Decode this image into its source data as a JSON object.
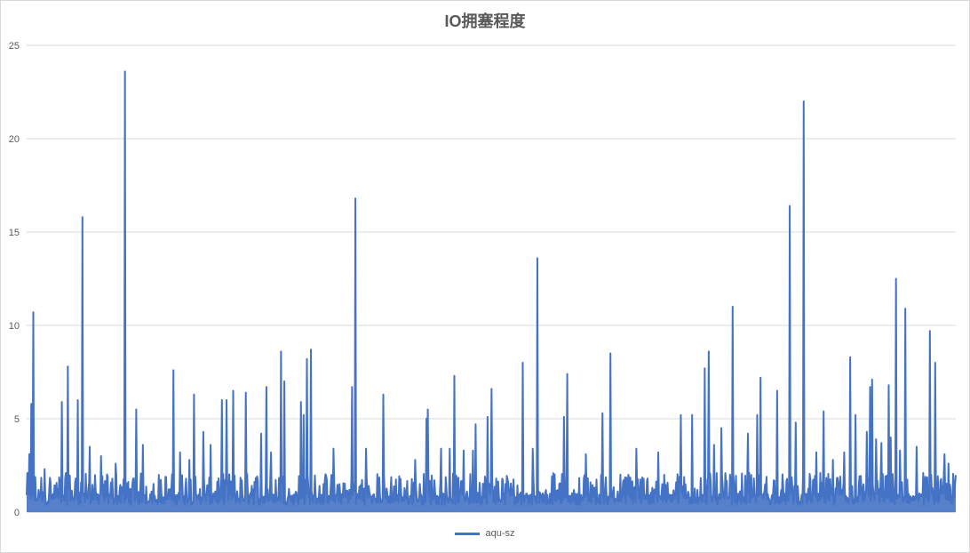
{
  "chart_data": {
    "type": "line",
    "title": "IO拥塞程度",
    "xlabel": "",
    "ylabel": "",
    "ylim": [
      0,
      25
    ],
    "yticks": [
      0,
      5,
      10,
      15,
      20,
      25
    ],
    "grid": true,
    "legend_position": "bottom",
    "series": [
      {
        "name": "aqu-sz",
        "color": "#4472c4",
        "baseline_range": [
          0.4,
          2.1
        ],
        "spikes": [
          {
            "x": 0.003,
            "y": 3.1
          },
          {
            "x": 0.005,
            "y": 5.8
          },
          {
            "x": 0.007,
            "y": 10.7
          },
          {
            "x": 0.019,
            "y": 2.3
          },
          {
            "x": 0.038,
            "y": 5.9
          },
          {
            "x": 0.044,
            "y": 7.8
          },
          {
            "x": 0.055,
            "y": 6.0
          },
          {
            "x": 0.06,
            "y": 15.8
          },
          {
            "x": 0.068,
            "y": 3.5
          },
          {
            "x": 0.08,
            "y": 3.0
          },
          {
            "x": 0.096,
            "y": 2.6
          },
          {
            "x": 0.106,
            "y": 23.6
          },
          {
            "x": 0.118,
            "y": 5.5
          },
          {
            "x": 0.125,
            "y": 3.6
          },
          {
            "x": 0.158,
            "y": 7.6
          },
          {
            "x": 0.165,
            "y": 3.2
          },
          {
            "x": 0.175,
            "y": 2.8
          },
          {
            "x": 0.18,
            "y": 6.3
          },
          {
            "x": 0.19,
            "y": 4.3
          },
          {
            "x": 0.198,
            "y": 3.6
          },
          {
            "x": 0.21,
            "y": 6.0
          },
          {
            "x": 0.215,
            "y": 6.0
          },
          {
            "x": 0.222,
            "y": 6.5
          },
          {
            "x": 0.236,
            "y": 6.4
          },
          {
            "x": 0.252,
            "y": 4.2
          },
          {
            "x": 0.258,
            "y": 6.7
          },
          {
            "x": 0.263,
            "y": 3.2
          },
          {
            "x": 0.274,
            "y": 8.6
          },
          {
            "x": 0.277,
            "y": 7.0
          },
          {
            "x": 0.295,
            "y": 5.9
          },
          {
            "x": 0.298,
            "y": 5.2
          },
          {
            "x": 0.302,
            "y": 8.2
          },
          {
            "x": 0.306,
            "y": 8.7
          },
          {
            "x": 0.33,
            "y": 3.4
          },
          {
            "x": 0.35,
            "y": 6.7
          },
          {
            "x": 0.354,
            "y": 16.8
          },
          {
            "x": 0.365,
            "y": 3.4
          },
          {
            "x": 0.384,
            "y": 6.3
          },
          {
            "x": 0.418,
            "y": 2.8
          },
          {
            "x": 0.43,
            "y": 5.0
          },
          {
            "x": 0.432,
            "y": 5.5
          },
          {
            "x": 0.446,
            "y": 3.4
          },
          {
            "x": 0.455,
            "y": 3.4
          },
          {
            "x": 0.46,
            "y": 7.3
          },
          {
            "x": 0.47,
            "y": 3.3
          },
          {
            "x": 0.48,
            "y": 3.3
          },
          {
            "x": 0.483,
            "y": 4.7
          },
          {
            "x": 0.496,
            "y": 5.1
          },
          {
            "x": 0.5,
            "y": 6.6
          },
          {
            "x": 0.534,
            "y": 8.0
          },
          {
            "x": 0.545,
            "y": 3.4
          },
          {
            "x": 0.55,
            "y": 13.6
          },
          {
            "x": 0.578,
            "y": 5.1
          },
          {
            "x": 0.582,
            "y": 7.4
          },
          {
            "x": 0.602,
            "y": 3.1
          },
          {
            "x": 0.62,
            "y": 5.3
          },
          {
            "x": 0.628,
            "y": 8.5
          },
          {
            "x": 0.656,
            "y": 3.4
          },
          {
            "x": 0.68,
            "y": 3.2
          },
          {
            "x": 0.704,
            "y": 5.2
          },
          {
            "x": 0.716,
            "y": 5.2
          },
          {
            "x": 0.73,
            "y": 7.7
          },
          {
            "x": 0.734,
            "y": 8.6
          },
          {
            "x": 0.74,
            "y": 3.6
          },
          {
            "x": 0.748,
            "y": 4.5
          },
          {
            "x": 0.76,
            "y": 11.0
          },
          {
            "x": 0.776,
            "y": 4.2
          },
          {
            "x": 0.786,
            "y": 5.2
          },
          {
            "x": 0.79,
            "y": 7.2
          },
          {
            "x": 0.808,
            "y": 6.5
          },
          {
            "x": 0.821,
            "y": 16.4
          },
          {
            "x": 0.828,
            "y": 4.8
          },
          {
            "x": 0.836,
            "y": 22.0
          },
          {
            "x": 0.85,
            "y": 3.2
          },
          {
            "x": 0.858,
            "y": 5.4
          },
          {
            "x": 0.868,
            "y": 2.8
          },
          {
            "x": 0.88,
            "y": 3.2
          },
          {
            "x": 0.886,
            "y": 8.3
          },
          {
            "x": 0.892,
            "y": 5.2
          },
          {
            "x": 0.904,
            "y": 4.3
          },
          {
            "x": 0.908,
            "y": 6.7
          },
          {
            "x": 0.91,
            "y": 7.1
          },
          {
            "x": 0.914,
            "y": 3.9
          },
          {
            "x": 0.92,
            "y": 3.7
          },
          {
            "x": 0.928,
            "y": 6.8
          },
          {
            "x": 0.93,
            "y": 4.0
          },
          {
            "x": 0.936,
            "y": 12.5
          },
          {
            "x": 0.94,
            "y": 3.3
          },
          {
            "x": 0.946,
            "y": 10.9
          },
          {
            "x": 0.958,
            "y": 3.5
          },
          {
            "x": 0.965,
            "y": 2.1
          },
          {
            "x": 0.972,
            "y": 9.7
          },
          {
            "x": 0.978,
            "y": 8.0
          },
          {
            "x": 0.988,
            "y": 3.1
          },
          {
            "x": 0.992,
            "y": 2.6
          }
        ]
      }
    ]
  }
}
